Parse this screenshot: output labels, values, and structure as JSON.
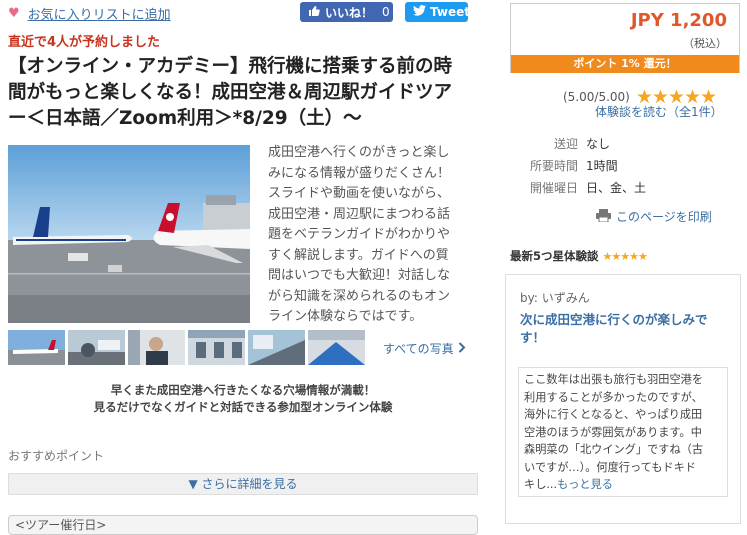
{
  "header": {
    "favorite_label": "お気に入りリストに追加",
    "like_label": "いいね！",
    "like_count": "0",
    "tweet_label": "Tweet"
  },
  "recent_booking": "直近で4人が予約しました",
  "title_lines": [
    "【オンライン・アカデミー】飛行機に搭乗する前の時",
    "間がもっと楽しくなる！成田空港＆周辺駅ガイドツア",
    "ー＜日本語／Zoom利用＞*8/29（土）～"
  ],
  "description_lines": [
    "成田空港へ行くのがきっと楽し",
    "みになる情報が盛りだくさん！",
    "スライドや動画を使いながら、",
    "成田空港・周辺駅にまつわる話",
    "題をベテランガイドがわかりや",
    "すく解説します。ガイドへの質",
    "問はいつでも大歓迎！対話しな",
    "がら知識を深められるのもオン",
    "ライン体験ならではです。"
  ],
  "all_photos_label": "すべての写真",
  "lead_lines": [
    "早くまた成田空港へ行きたくなる穴場情報が満載！",
    "見るだけでなくガイドと対話できる参加型オンライン体験"
  ],
  "recommend_label": "おすすめポイント",
  "more_details_label": "▼ さらに詳細を見る",
  "tour_date_header": "<ツアー催行日>",
  "price": {
    "amount": "JPY 1,200",
    "tax_note": "（税込）",
    "points": "ポイント 1% 還元！"
  },
  "rating": {
    "score_text": "(5.00/5.00)",
    "stars": 5,
    "read_reviews": "体験談を読む（全1件）"
  },
  "info_rows": [
    {
      "key": "送迎",
      "value": "なし"
    },
    {
      "key": "所要時間",
      "value": "1時間"
    },
    {
      "key": "開催曜日",
      "value": "日、金、土"
    }
  ],
  "print_label": "このページを印刷",
  "reviews": {
    "header": "最新5つ星体験談",
    "author": "by: いずみん",
    "title_lines": [
      "次に成田空港に行くのが楽しみで",
      "す！"
    ],
    "body_lines": [
      "ここ数年は出張も旅行も羽田空港を",
      "利用することが多かったのですが、",
      "海外に行くとなると、やっぱり成田",
      "空港のほうが雰囲気があります。中",
      "森明菜の「北ウイング」ですね（古",
      "いですが…）。何度行ってもドキド"
    ],
    "body_last": "キし...",
    "more_label": "もっと見る"
  },
  "colors": {
    "accent_orange": "#f08a1c",
    "price_red": "#e2572a",
    "link_blue": "#3a6ea5",
    "facebook": "#4267b2",
    "twitter": "#1d9bf0",
    "recent_red": "#c8331f"
  }
}
